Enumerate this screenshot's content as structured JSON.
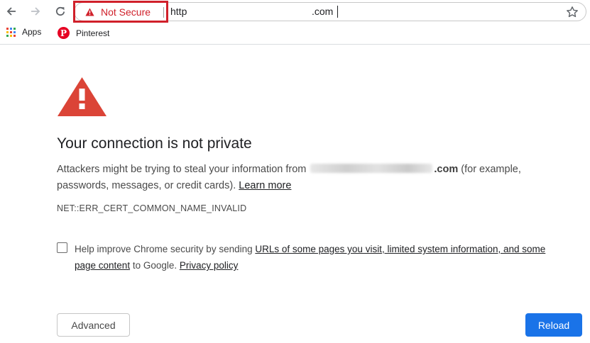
{
  "browser": {
    "nav": {
      "back_icon": "arrow-left-icon",
      "forward_icon": "arrow-right-icon",
      "reload_icon": "reload-icon"
    },
    "omnibox": {
      "security_label": "Not Secure",
      "security_icon": "warning-triangle-icon",
      "url_scheme": "http",
      "url_tail": ".com",
      "bookmark_icon": "star-icon",
      "highlight_color": "#d0202a"
    },
    "bookmarks": [
      {
        "label": "Apps",
        "icon": "apps-grid-icon"
      },
      {
        "label": "Pinterest",
        "icon": "pinterest-icon"
      }
    ]
  },
  "interstitial": {
    "icon": "warning-triangle-icon",
    "icon_color": "#db4437",
    "headline": "Your connection is not private",
    "desc_before": "Attackers might be trying to steal your information from ",
    "desc_domain_tail": ".com",
    "desc_after": " (for example, passwords, messages, or credit cards). ",
    "learn_more": "Learn more",
    "error_code": "NET::ERR_CERT_COMMON_NAME_INVALID",
    "optin": {
      "checked": false,
      "text_before": "Help improve Chrome security by sending ",
      "link_urls": "URLs of some pages you visit, limited system information, and some page content",
      "text_middle": " to Google. ",
      "link_privacy": "Privacy policy"
    },
    "buttons": {
      "advanced": "Advanced",
      "reload": "Reload",
      "reload_color": "#1a73e8"
    }
  }
}
